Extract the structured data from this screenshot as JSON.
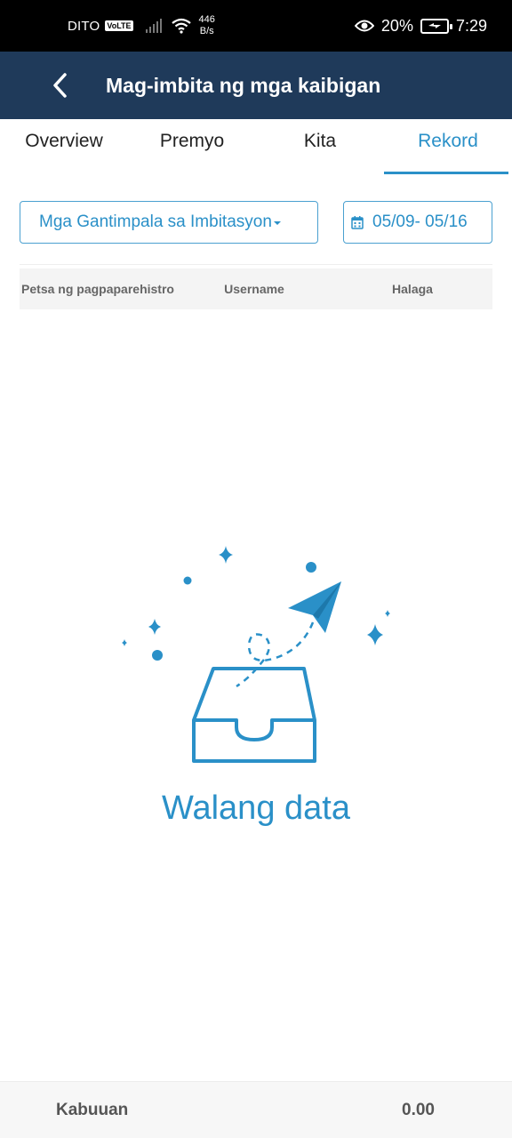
{
  "status_bar": {
    "carrier": "DITO",
    "volte": "VoLTE",
    "speed_value": "446",
    "speed_unit": "B/s",
    "battery_percent": "20%",
    "time": "7:29"
  },
  "header": {
    "title": "Mag-imbita ng mga kaibigan",
    "back_icon": "chevron-left-icon"
  },
  "tabs": [
    {
      "label": "Overview",
      "active": false
    },
    {
      "label": "Premyo",
      "active": false
    },
    {
      "label": "Kita",
      "active": false
    },
    {
      "label": "Rekord",
      "active": true
    }
  ],
  "filters": {
    "type_selected": "Mga Gantimpala sa Imbitasyon",
    "date_range": "05/09- 05/16"
  },
  "table": {
    "columns": [
      "Petsa ng pagpaparehistro",
      "Username",
      "Halaga"
    ],
    "rows": []
  },
  "empty_state": {
    "text": "Walang data"
  },
  "footer": {
    "label": "Kabuuan",
    "value": "0.00"
  },
  "colors": {
    "accent": "#2a90c8",
    "header_bg": "#1f3a5a",
    "status_bar_bg": "#000000"
  }
}
